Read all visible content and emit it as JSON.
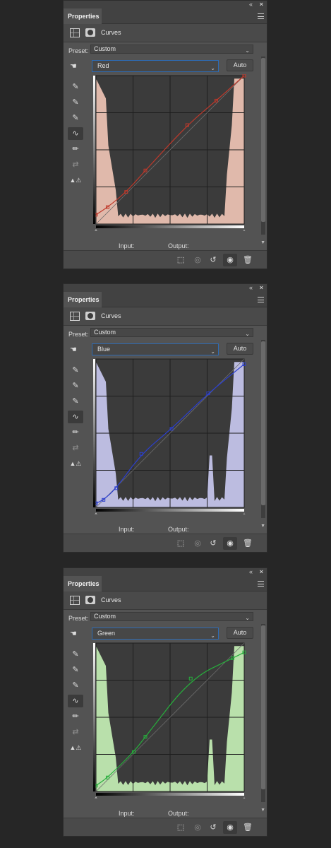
{
  "common": {
    "double_arrow": "«",
    "close": "×",
    "tab": "Properties",
    "adjustment_title": "Curves",
    "preset_label": "Preset:",
    "preset_value": "Custom",
    "auto_label": "Auto",
    "input_label": "Input:",
    "output_label": "Output:",
    "tool_sample": "⟜",
    "footer_icons": [
      "clip-to-layer-icon",
      "view-previous-icon",
      "reset-icon",
      "visibility-icon",
      "delete-icon"
    ]
  },
  "panels": [
    {
      "channel": "Red",
      "curve_color": "#c0392b",
      "histogram_color": "#f3c8b8",
      "curve_points": [
        [
          0,
          12
        ],
        [
          15,
          22
        ],
        [
          40,
          42
        ],
        [
          65,
          70
        ],
        [
          120,
          130
        ],
        [
          158,
          162
        ],
        [
          195,
          195
        ]
      ]
    },
    {
      "channel": "Blue",
      "curve_color": "#2b3fcf",
      "histogram_color": "#cbcbf3",
      "curve_points": [
        [
          0,
          5
        ],
        [
          10,
          10
        ],
        [
          27,
          25
        ],
        [
          60,
          70
        ],
        [
          99,
          103
        ],
        [
          148,
          150
        ],
        [
          195,
          188
        ]
      ]
    },
    {
      "channel": "Green",
      "curve_color": "#27ae3c",
      "histogram_color": "#c8f3b8",
      "curve_points": [
        [
          0,
          8
        ],
        [
          15,
          18
        ],
        [
          50,
          52
        ],
        [
          65,
          72
        ],
        [
          125,
          148
        ],
        [
          180,
          175
        ],
        [
          195,
          183
        ]
      ]
    }
  ],
  "chart_data": [
    {
      "type": "line",
      "title": "",
      "xlabel": "Input",
      "ylabel": "Output",
      "xlim": [
        0,
        255
      ],
      "ylim": [
        0,
        255
      ],
      "series": [
        {
          "name": "Red",
          "x": [
            0,
            20,
            52,
            85,
            157,
            207,
            255
          ],
          "y": [
            16,
            29,
            55,
            92,
            170,
            212,
            255
          ]
        }
      ]
    },
    {
      "type": "line",
      "title": "",
      "xlabel": "Input",
      "ylabel": "Output",
      "xlim": [
        0,
        255
      ],
      "ylim": [
        0,
        255
      ],
      "series": [
        {
          "name": "Blue",
          "x": [
            0,
            13,
            35,
            78,
            130,
            193,
            255
          ],
          "y": [
            7,
            13,
            33,
            92,
            135,
            196,
            246
          ]
        }
      ]
    },
    {
      "type": "line",
      "title": "",
      "xlabel": "Input",
      "ylabel": "Output",
      "xlim": [
        0,
        255
      ],
      "ylim": [
        0,
        255
      ],
      "series": [
        {
          "name": "Green",
          "x": [
            0,
            20,
            65,
            85,
            163,
            235,
            255
          ],
          "y": [
            10,
            24,
            68,
            94,
            194,
            229,
            239
          ]
        }
      ]
    }
  ]
}
